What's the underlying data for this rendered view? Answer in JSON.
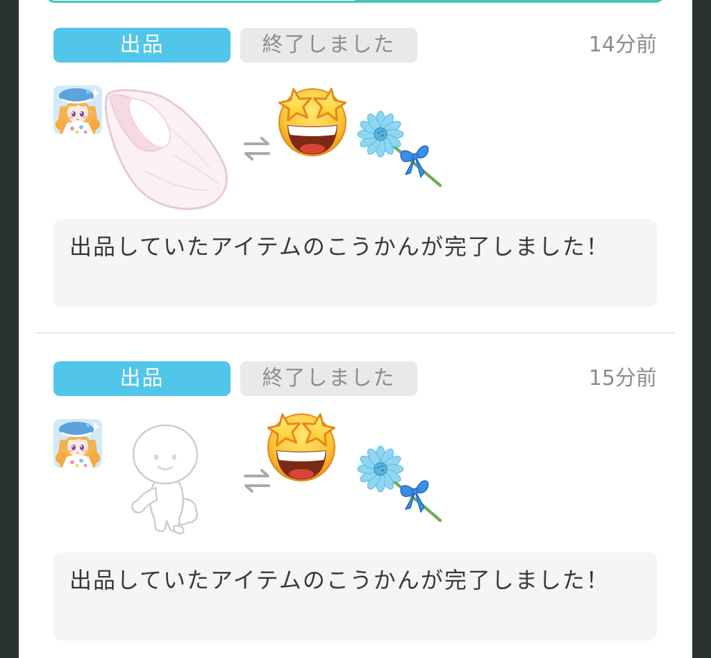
{
  "colors": {
    "background": "#2a3332",
    "card": "#ffffff",
    "tab_accent": "#3fc6b5",
    "type_badge": "#52c6ea",
    "status_badge": "#e9e9ec",
    "muted_text": "#8c8c8c",
    "message_box": "#f5f5f7",
    "message_text": "#383838"
  },
  "notifications": [
    {
      "type_label": "出品",
      "status_label": "終了しました",
      "time": "14分前",
      "avatar_icon": "user-avatar-icon",
      "listed_item_icon": "pink-bib-icon",
      "exchange_icon": "exchange-arrows-icon",
      "received_item_icons": [
        "star-struck-emoji-icon",
        "blue-flower-icon"
      ],
      "message": "出品していたアイテムのこうかんが完了しました！"
    },
    {
      "type_label": "出品",
      "status_label": "終了しました",
      "time": "15分前",
      "avatar_icon": "user-avatar-icon",
      "listed_item_icon": "doll-body-icon",
      "exchange_icon": "exchange-arrows-icon",
      "received_item_icons": [
        "star-struck-emoji-icon",
        "blue-flower-icon"
      ],
      "message": "出品していたアイテムのこうかんが完了しました！"
    }
  ]
}
